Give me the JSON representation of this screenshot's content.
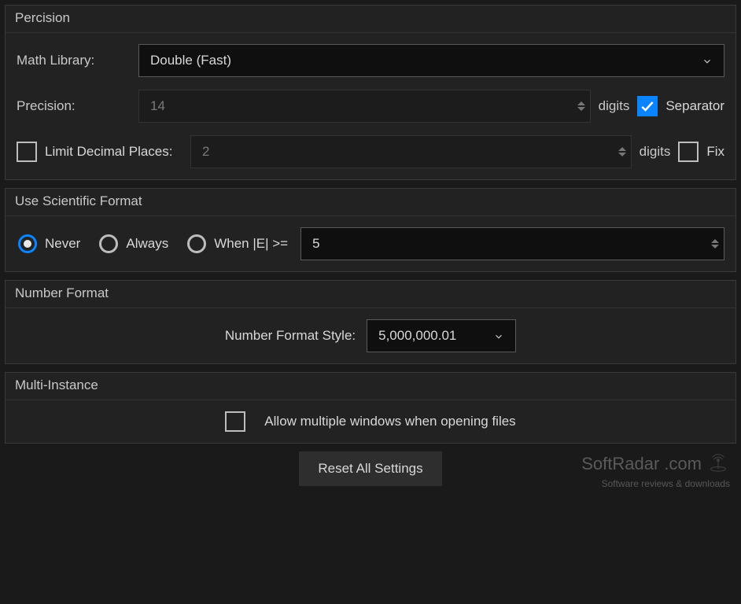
{
  "precision_group": {
    "title": "Percision",
    "math_library_label": "Math Library:",
    "math_library_value": "Double (Fast)",
    "precision_label": "Precision:",
    "precision_value": "14",
    "precision_unit": "digits",
    "separator_checked": true,
    "separator_label": "Separator",
    "limit_decimal_checked": false,
    "limit_decimal_label": "Limit Decimal Places:",
    "limit_decimal_value": "2",
    "limit_decimal_unit": "digits",
    "fix_checked": false,
    "fix_label": "Fix"
  },
  "scientific_group": {
    "title": "Use Scientific Format",
    "options": {
      "never": "Never",
      "always": "Always",
      "when_e": "When |E| >="
    },
    "selected": "never",
    "threshold_value": "5"
  },
  "number_format_group": {
    "title": "Number Format",
    "style_label": "Number Format Style:",
    "style_value": "5,000,000.01"
  },
  "multi_instance_group": {
    "title": "Multi-Instance",
    "allow_multiple_checked": false,
    "allow_multiple_label": "Allow multiple windows when opening files"
  },
  "footer": {
    "reset_button": "Reset All Settings",
    "watermark_main": "SoftRadar",
    "watermark_dotcom": ".com",
    "watermark_sub": "Software reviews & downloads"
  }
}
